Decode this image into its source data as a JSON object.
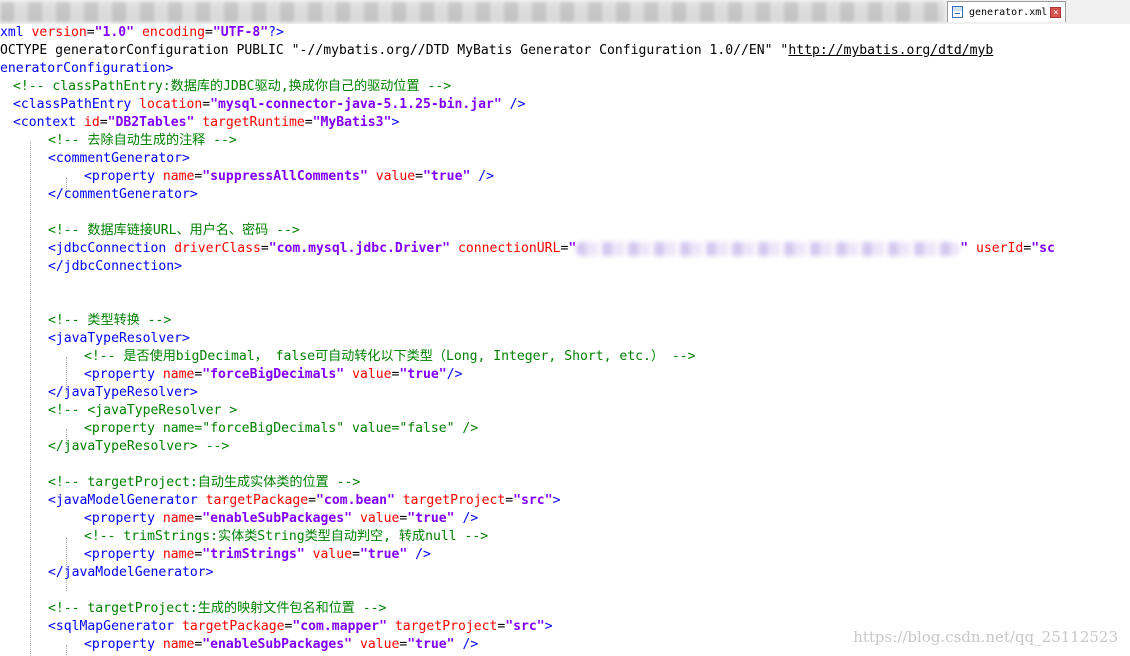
{
  "tab": {
    "label": "generator.xml"
  },
  "editor": {
    "l1": {
      "a": "xml ",
      "b": "version",
      "c": "=",
      "d": "\"1.0\"",
      "e": " ",
      "f": "encoding",
      "g": "=",
      "h": "\"UTF-8\"",
      "i": "?>"
    },
    "l2": {
      "a": "OCTYPE generatorConfiguration PUBLIC \"-//mybatis.org//DTD MyBatis Generator Configuration 1.0//EN\" \"",
      "url": "http://mybatis.org/dtd/myb"
    },
    "l3": {
      "a": "eneratorConfiguration>"
    },
    "l4": {
      "a": "<!-- classPathEntry:数据库的JDBC驱动,换成你自己的驱动位置 -->"
    },
    "l5": {
      "a": "<classPathEntry ",
      "b": "location",
      "c": "=",
      "d": "\"mysql-connector-java-5.1.25-bin.jar\"",
      "e": " />"
    },
    "l6": {
      "a": "<context ",
      "b": "id",
      "c": "=",
      "d": "\"DB2Tables\"",
      "e": " ",
      "f": "targetRuntime",
      "g": "=",
      "h": "\"MyBatis3\"",
      "i": ">"
    },
    "l7": {
      "a": "<!-- 去除自动生成的注释 -->"
    },
    "l8": {
      "a": "<commentGenerator>"
    },
    "l9": {
      "a": "<property ",
      "b": "name",
      "c": "=",
      "d": "\"suppressAllComments\"",
      "e": " ",
      "f": "value",
      "g": "=",
      "h": "\"true\"",
      "i": " />"
    },
    "l10": {
      "a": "</commentGenerator>"
    },
    "l11": {
      "a": "<!-- 数据库链接URL、用户名、密码 -->"
    },
    "l12": {
      "a": "<jdbcConnection ",
      "b": "driverClass",
      "c": "=",
      "d": "\"com.mysql.jdbc.Driver\"",
      "e": " ",
      "f": "connectionURL",
      "g": "=",
      "h": "\"",
      "i": "\"",
      "j": " ",
      "k": "userId",
      "l": "=",
      "m": "\"sc"
    },
    "l13": {
      "a": "</jdbcConnection>"
    },
    "l14": {
      "a": "<!-- 类型转换 -->"
    },
    "l15": {
      "a": "<javaTypeResolver>"
    },
    "l16": {
      "a": "<!-- 是否使用bigDecimal， false可自动转化以下类型（Long, Integer, Short, etc.） -->"
    },
    "l17": {
      "a": "<property ",
      "b": "name",
      "c": "=",
      "d": "\"forceBigDecimals\"",
      "e": " ",
      "f": "value",
      "g": "=",
      "h": "\"true\"",
      "i": "/>"
    },
    "l18": {
      "a": "</javaTypeResolver>"
    },
    "l19": {
      "a": "<!-- <javaTypeResolver >"
    },
    "l20": {
      "a": "<property name=\"forceBigDecimals\" value=\"false\" />"
    },
    "l21": {
      "a": "</javaTypeResolver> -->"
    },
    "l22": {
      "a": "<!-- targetProject:自动生成实体类的位置 -->"
    },
    "l23": {
      "a": "<javaModelGenerator ",
      "b": "targetPackage",
      "c": "=",
      "d": "\"com.bean\"",
      "e": " ",
      "f": "targetProject",
      "g": "=",
      "h": "\"src\"",
      "i": ">"
    },
    "l24": {
      "a": "<property ",
      "b": "name",
      "c": "=",
      "d": "\"enableSubPackages\"",
      "e": " ",
      "f": "value",
      "g": "=",
      "h": "\"true\"",
      "i": " />"
    },
    "l25": {
      "a": "<!-- trimStrings:实体类String类型自动判空, 转成null -->"
    },
    "l26": {
      "a": "<property ",
      "b": "name",
      "c": "=",
      "d": "\"trimStrings\"",
      "e": " ",
      "f": "value",
      "g": "=",
      "h": "\"true\"",
      "i": " />"
    },
    "l27": {
      "a": "</javaModelGenerator>"
    },
    "l28": {
      "a": "<!-- targetProject:生成的映射文件包名和位置 -->"
    },
    "l29": {
      "a": "<sqlMapGenerator ",
      "b": "targetPackage",
      "c": "=",
      "d": "\"com.mapper\"",
      "e": " ",
      "f": "targetProject",
      "g": "=",
      "h": "\"src\"",
      "i": ">"
    },
    "l30": {
      "a": "<property ",
      "b": "name",
      "c": "=",
      "d": "\"enableSubPackages\"",
      "e": " ",
      "f": "value",
      "g": "=",
      "h": "\"true\"",
      "i": " />"
    }
  },
  "watermark": "https://blog.csdn.net/qq_25112523"
}
